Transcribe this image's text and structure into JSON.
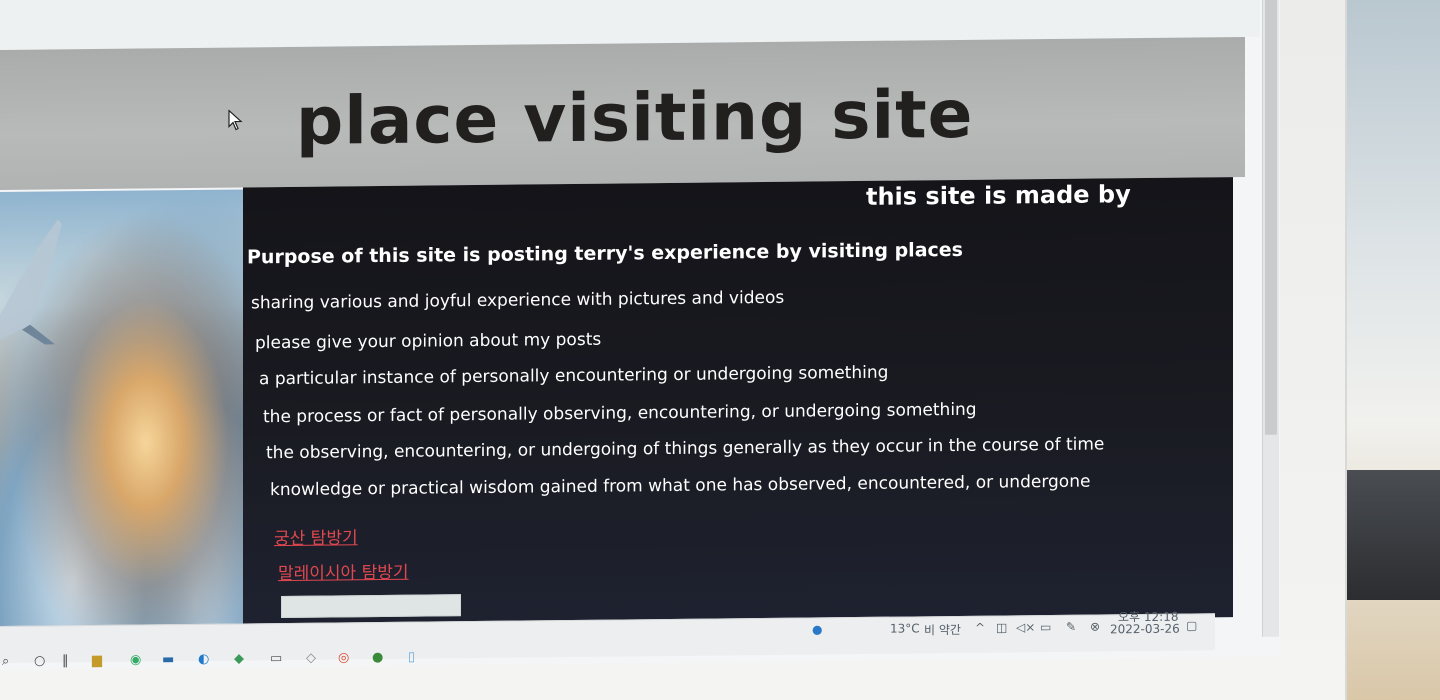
{
  "header": {
    "title": "place visiting site"
  },
  "content": {
    "made_by": "this site is made by",
    "purpose": "Purpose of this site is posting terry's experience by visiting places",
    "lines": [
      "sharing various and joyful experience with pictures and videos",
      "please give your opinion about my posts",
      "a particular instance of personally encountering or undergoing something",
      "the process or fact of personally observing, encountering, or undergoing something",
      "the observing, encountering, or undergoing of things generally as they occur in the course of time",
      "knowledge or practical wisdom gained from what one has observed, encountered, or undergone"
    ],
    "links": [
      "궁산 탐방기",
      "말레이시아 탐방기"
    ],
    "input_value": ""
  },
  "taskbar": {
    "weather": "13°C",
    "weather_desc": "비 약간",
    "time": "오후 12:18",
    "date": "2022-03-26"
  },
  "colors": {
    "header_bg": "#b0b3b2",
    "content_bg": "#1a1b22",
    "link": "#e0474f",
    "title": "#221f1f"
  },
  "icons": [
    "cursor-icon",
    "search-icon",
    "cortana-icon",
    "task-view-icon",
    "file-explorer-icon",
    "edge-icon",
    "chrome-icon",
    "notification-icon",
    "volume-icon",
    "network-icon",
    "battery-icon",
    "pen-icon"
  ]
}
